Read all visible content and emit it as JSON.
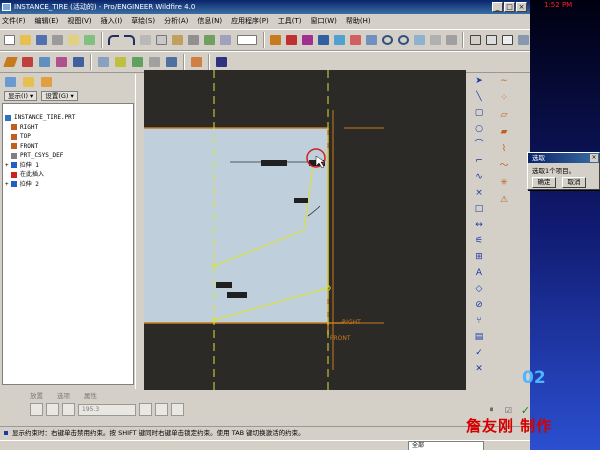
{
  "window": {
    "title": "INSTANCE_TIRE (活动的) - Pro/ENGINEER Wildfire 4.0",
    "buttons": [
      "_",
      "□",
      "×"
    ]
  },
  "menu": [
    "文件(F)",
    "编辑(E)",
    "视图(V)",
    "插入(I)",
    "草绘(S)",
    "分析(A)",
    "信息(N)",
    "应用程序(P)",
    "工具(T)",
    "窗口(W)",
    "帮助(H)"
  ],
  "left_panel": {
    "show_label": "显示(I) ▾",
    "settings_label": "设置(G) ▾",
    "tree": [
      {
        "label": "INSTANCE_TIRE.PRT",
        "icon": "part-icon",
        "color": "#3070c0",
        "indent": 0
      },
      {
        "label": "RIGHT",
        "icon": "datum-plane-icon",
        "color": "#c06020",
        "indent": 1
      },
      {
        "label": "TOP",
        "icon": "datum-plane-icon",
        "color": "#c06020",
        "indent": 1
      },
      {
        "label": "FRONT",
        "icon": "datum-plane-icon",
        "color": "#c06020",
        "indent": 1
      },
      {
        "label": "PRT_CSYS_DEF",
        "icon": "csys-icon",
        "color": "#808080",
        "indent": 1
      },
      {
        "label": "拉伸 1",
        "icon": "extrude-icon",
        "color": "#2060c0",
        "indent": 0,
        "expander": "+"
      },
      {
        "label": "在此插入",
        "icon": "insert-here-icon",
        "color": "#d02020",
        "indent": 1
      },
      {
        "label": "拉伸 2",
        "icon": "extrude-icon",
        "color": "#2060c0",
        "indent": 0,
        "expander": "+"
      }
    ]
  },
  "canvas": {
    "label_right": "RIGHT",
    "label_front": "FRONT",
    "dims": [
      "D",
      "D",
      "D",
      "D"
    ]
  },
  "dashboard": {
    "tabs": [
      "放置",
      "选项",
      "属性"
    ],
    "depth_value": "195.3"
  },
  "message": "显示约束时：右键单击禁用约束。按 SHIFT 键同时右键单击锁定约束。使用 TAB 键切换激活的约束。",
  "status_combo": "全部",
  "dialog": {
    "title": "选取",
    "text": "选取1个项目。",
    "ok": "确定",
    "cancel": "取消",
    "close": "×"
  },
  "overlay": {
    "top_right": "1:52 PM",
    "big_number": "02",
    "watermark": "詹友刚 制作"
  },
  "colors": {
    "sketch_bg": "#bfd0dc",
    "canvas_bg": "#2c2a26",
    "datum": "#c87a1e",
    "sketch_line": "#d8e040",
    "accent_red": "#d02020"
  }
}
